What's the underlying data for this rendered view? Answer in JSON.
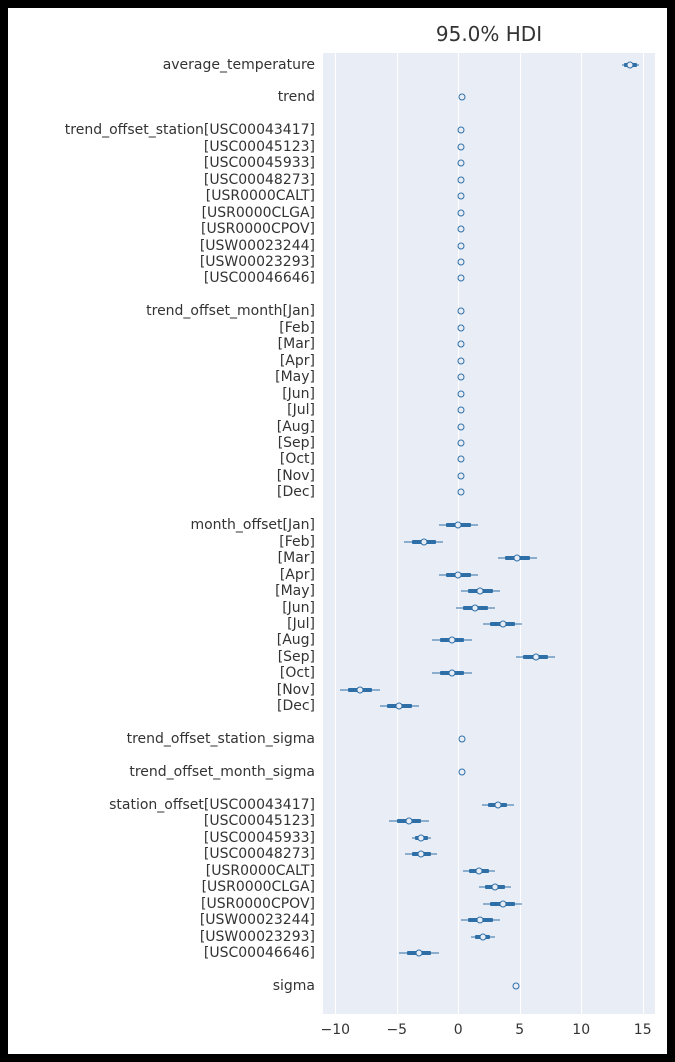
{
  "chart_data": {
    "type": "forest",
    "title": "95.0% HDI",
    "xlim": [
      -11,
      16
    ],
    "xticks": [
      -10,
      -5,
      0,
      5,
      10,
      15
    ],
    "groups": [
      {
        "gap_before": 0,
        "rows": [
          {
            "label": "average_temperature",
            "mean": 14.0,
            "lo90": 13.5,
            "hi90": 14.5,
            "lo95": 13.3,
            "hi95": 14.7
          }
        ]
      },
      {
        "gap_before": 1,
        "rows": [
          {
            "label": "trend",
            "mean": 0.3,
            "lo90": 0.3,
            "hi90": 0.3,
            "lo95": 0.3,
            "hi95": 0.3
          }
        ]
      },
      {
        "gap_before": 1,
        "rows": [
          {
            "label": "trend_offset_station[USC00043417]",
            "mean": 0.2,
            "lo90": 0.2,
            "hi90": 0.2,
            "lo95": 0.2,
            "hi95": 0.2
          },
          {
            "label": "[USC00045123]",
            "mean": 0.2,
            "lo90": 0.2,
            "hi90": 0.2,
            "lo95": 0.2,
            "hi95": 0.2
          },
          {
            "label": "[USC00045933]",
            "mean": 0.2,
            "lo90": 0.2,
            "hi90": 0.2,
            "lo95": 0.2,
            "hi95": 0.2
          },
          {
            "label": "[USC00048273]",
            "mean": 0.2,
            "lo90": 0.2,
            "hi90": 0.2,
            "lo95": 0.2,
            "hi95": 0.2
          },
          {
            "label": "[USR0000CALT]",
            "mean": 0.2,
            "lo90": 0.2,
            "hi90": 0.2,
            "lo95": 0.2,
            "hi95": 0.2
          },
          {
            "label": "[USR0000CLGA]",
            "mean": 0.2,
            "lo90": 0.2,
            "hi90": 0.2,
            "lo95": 0.2,
            "hi95": 0.2
          },
          {
            "label": "[USR0000CPOV]",
            "mean": 0.2,
            "lo90": 0.2,
            "hi90": 0.2,
            "lo95": 0.2,
            "hi95": 0.2
          },
          {
            "label": "[USW00023244]",
            "mean": 0.2,
            "lo90": 0.2,
            "hi90": 0.2,
            "lo95": 0.2,
            "hi95": 0.2
          },
          {
            "label": "[USW00023293]",
            "mean": 0.2,
            "lo90": 0.2,
            "hi90": 0.2,
            "lo95": 0.2,
            "hi95": 0.2
          },
          {
            "label": "[USC00046646]",
            "mean": 0.2,
            "lo90": 0.2,
            "hi90": 0.2,
            "lo95": 0.2,
            "hi95": 0.2
          }
        ]
      },
      {
        "gap_before": 1,
        "rows": [
          {
            "label": "trend_offset_month[Jan]",
            "mean": 0.2,
            "lo90": 0.2,
            "hi90": 0.2,
            "lo95": 0.2,
            "hi95": 0.2
          },
          {
            "label": "[Feb]",
            "mean": 0.2,
            "lo90": 0.2,
            "hi90": 0.2,
            "lo95": 0.2,
            "hi95": 0.2
          },
          {
            "label": "[Mar]",
            "mean": 0.2,
            "lo90": 0.2,
            "hi90": 0.2,
            "lo95": 0.2,
            "hi95": 0.2
          },
          {
            "label": "[Apr]",
            "mean": 0.2,
            "lo90": 0.2,
            "hi90": 0.2,
            "lo95": 0.2,
            "hi95": 0.2
          },
          {
            "label": "[May]",
            "mean": 0.2,
            "lo90": 0.2,
            "hi90": 0.2,
            "lo95": 0.2,
            "hi95": 0.2
          },
          {
            "label": "[Jun]",
            "mean": 0.2,
            "lo90": 0.2,
            "hi90": 0.2,
            "lo95": 0.2,
            "hi95": 0.2
          },
          {
            "label": "[Jul]",
            "mean": 0.2,
            "lo90": 0.2,
            "hi90": 0.2,
            "lo95": 0.2,
            "hi95": 0.2
          },
          {
            "label": "[Aug]",
            "mean": 0.2,
            "lo90": 0.2,
            "hi90": 0.2,
            "lo95": 0.2,
            "hi95": 0.2
          },
          {
            "label": "[Sep]",
            "mean": 0.2,
            "lo90": 0.2,
            "hi90": 0.2,
            "lo95": 0.2,
            "hi95": 0.2
          },
          {
            "label": "[Oct]",
            "mean": 0.2,
            "lo90": 0.2,
            "hi90": 0.2,
            "lo95": 0.2,
            "hi95": 0.2
          },
          {
            "label": "[Nov]",
            "mean": 0.2,
            "lo90": 0.2,
            "hi90": 0.2,
            "lo95": 0.2,
            "hi95": 0.2
          },
          {
            "label": "[Dec]",
            "mean": 0.2,
            "lo90": 0.2,
            "hi90": 0.2,
            "lo95": 0.2,
            "hi95": 0.2
          }
        ]
      },
      {
        "gap_before": 1,
        "rows": [
          {
            "label": "month_offset[Jan]",
            "mean": 0.0,
            "lo90": -1.0,
            "hi90": 1.0,
            "lo95": -1.6,
            "hi95": 1.6
          },
          {
            "label": "[Feb]",
            "mean": -2.8,
            "lo90": -3.8,
            "hi90": -1.8,
            "lo95": -4.4,
            "hi95": -1.2
          },
          {
            "label": "[Mar]",
            "mean": 4.8,
            "lo90": 3.8,
            "hi90": 5.8,
            "lo95": 3.2,
            "hi95": 6.4
          },
          {
            "label": "[Apr]",
            "mean": 0.0,
            "lo90": -1.0,
            "hi90": 1.0,
            "lo95": -1.6,
            "hi95": 1.6
          },
          {
            "label": "[May]",
            "mean": 1.8,
            "lo90": 0.8,
            "hi90": 2.8,
            "lo95": 0.2,
            "hi95": 3.4
          },
          {
            "label": "[Jun]",
            "mean": 1.4,
            "lo90": 0.4,
            "hi90": 2.4,
            "lo95": -0.2,
            "hi95": 3.0
          },
          {
            "label": "[Jul]",
            "mean": 3.6,
            "lo90": 2.6,
            "hi90": 4.6,
            "lo95": 2.0,
            "hi95": 5.2
          },
          {
            "label": "[Aug]",
            "mean": -0.5,
            "lo90": -1.5,
            "hi90": 0.5,
            "lo95": -2.1,
            "hi95": 1.1
          },
          {
            "label": "[Sep]",
            "mean": 6.3,
            "lo90": 5.3,
            "hi90": 7.3,
            "lo95": 4.7,
            "hi95": 7.9
          },
          {
            "label": "[Oct]",
            "mean": -0.5,
            "lo90": -1.5,
            "hi90": 0.5,
            "lo95": -2.1,
            "hi95": 1.1
          },
          {
            "label": "[Nov]",
            "mean": -8.0,
            "lo90": -9.0,
            "hi90": -7.0,
            "lo95": -9.6,
            "hi95": -6.4
          },
          {
            "label": "[Dec]",
            "mean": -4.8,
            "lo90": -5.8,
            "hi90": -3.8,
            "lo95": -6.4,
            "hi95": -3.2
          }
        ]
      },
      {
        "gap_before": 1,
        "rows": [
          {
            "label": "trend_offset_station_sigma",
            "mean": 0.3,
            "lo90": 0.3,
            "hi90": 0.3,
            "lo95": 0.3,
            "hi95": 0.3
          }
        ]
      },
      {
        "gap_before": 1,
        "rows": [
          {
            "label": "trend_offset_month_sigma",
            "mean": 0.3,
            "lo90": 0.3,
            "hi90": 0.3,
            "lo95": 0.3,
            "hi95": 0.3
          }
        ]
      },
      {
        "gap_before": 1,
        "rows": [
          {
            "label": "station_offset[USC00043417]",
            "mean": 3.2,
            "lo90": 2.4,
            "hi90": 4.0,
            "lo95": 1.9,
            "hi95": 4.5
          },
          {
            "label": "[USC00045123]",
            "mean": -4.0,
            "lo90": -5.0,
            "hi90": -3.0,
            "lo95": -5.6,
            "hi95": -2.4
          },
          {
            "label": "[USC00045933]",
            "mean": -3.0,
            "lo90": -3.5,
            "hi90": -2.5,
            "lo95": -3.8,
            "hi95": -2.2
          },
          {
            "label": "[USC00048273]",
            "mean": -3.0,
            "lo90": -3.8,
            "hi90": -2.2,
            "lo95": -4.3,
            "hi95": -1.7
          },
          {
            "label": "[USR0000CALT]",
            "mean": 1.7,
            "lo90": 0.9,
            "hi90": 2.5,
            "lo95": 0.4,
            "hi95": 3.0
          },
          {
            "label": "[USR0000CLGA]",
            "mean": 3.0,
            "lo90": 2.2,
            "hi90": 3.8,
            "lo95": 1.7,
            "hi95": 4.3
          },
          {
            "label": "[USR0000CPOV]",
            "mean": 3.6,
            "lo90": 2.6,
            "hi90": 4.6,
            "lo95": 2.0,
            "hi95": 5.2
          },
          {
            "label": "[USW00023244]",
            "mean": 1.8,
            "lo90": 0.8,
            "hi90": 2.8,
            "lo95": 0.2,
            "hi95": 3.4
          },
          {
            "label": "[USW00023293]",
            "mean": 2.0,
            "lo90": 1.4,
            "hi90": 2.6,
            "lo95": 1.0,
            "hi95": 3.0
          },
          {
            "label": "[USC00046646]",
            "mean": -3.2,
            "lo90": -4.2,
            "hi90": -2.2,
            "lo95": -4.8,
            "hi95": -1.6
          }
        ]
      },
      {
        "gap_before": 1,
        "rows": [
          {
            "label": "sigma",
            "mean": 4.7,
            "lo90": 4.7,
            "hi90": 4.7,
            "lo95": 4.7,
            "hi95": 4.7
          }
        ]
      }
    ]
  }
}
